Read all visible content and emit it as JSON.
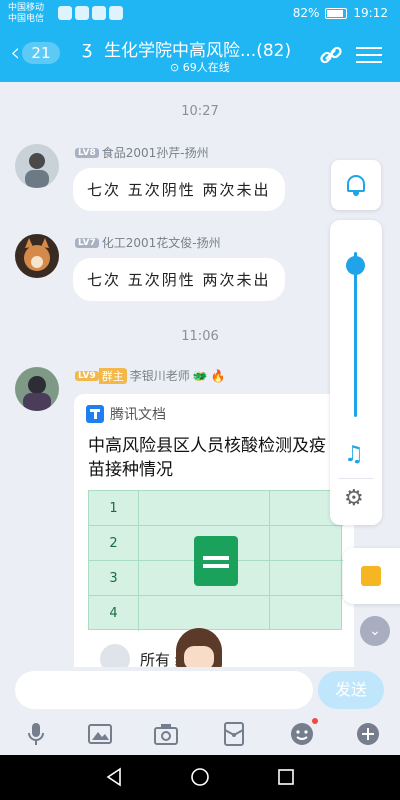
{
  "status_bar": {
    "carrier_1": "中国移动",
    "carrier_2": "中国电信",
    "battery": "82%",
    "time": "19:12"
  },
  "header": {
    "unread_count": "21",
    "title": "生化学院中高风险...(82)",
    "online": "69人在线"
  },
  "chat": {
    "time_1": "10:27",
    "time_2": "11:06",
    "messages": [
      {
        "level": "LV8",
        "sender": "食品2001孙芹-扬州",
        "text": "七次 五次阴性 两次未出"
      },
      {
        "level": "LV7",
        "sender": "化工2001花文俊-扬州",
        "text": "七次 五次阴性 两次未出"
      }
    ],
    "card_message": {
      "level": "LV9",
      "role": "群主",
      "sender": "李银川老师",
      "card_source": "腾讯文档",
      "card_title": "中高风险县区人员核酸检测及疫苗接种情况",
      "row_labels": [
        "1",
        "2",
        "3",
        "4"
      ],
      "footer_text": "所有          编辑"
    }
  },
  "floating_panel": {
    "volume_level": 0.92
  },
  "input": {
    "placeholder": "",
    "send_label": "发送"
  },
  "colors": {
    "brand_blue": "#1fb6f3",
    "accent": "#1fa4ea",
    "sheet_green": "#1aa15b"
  }
}
